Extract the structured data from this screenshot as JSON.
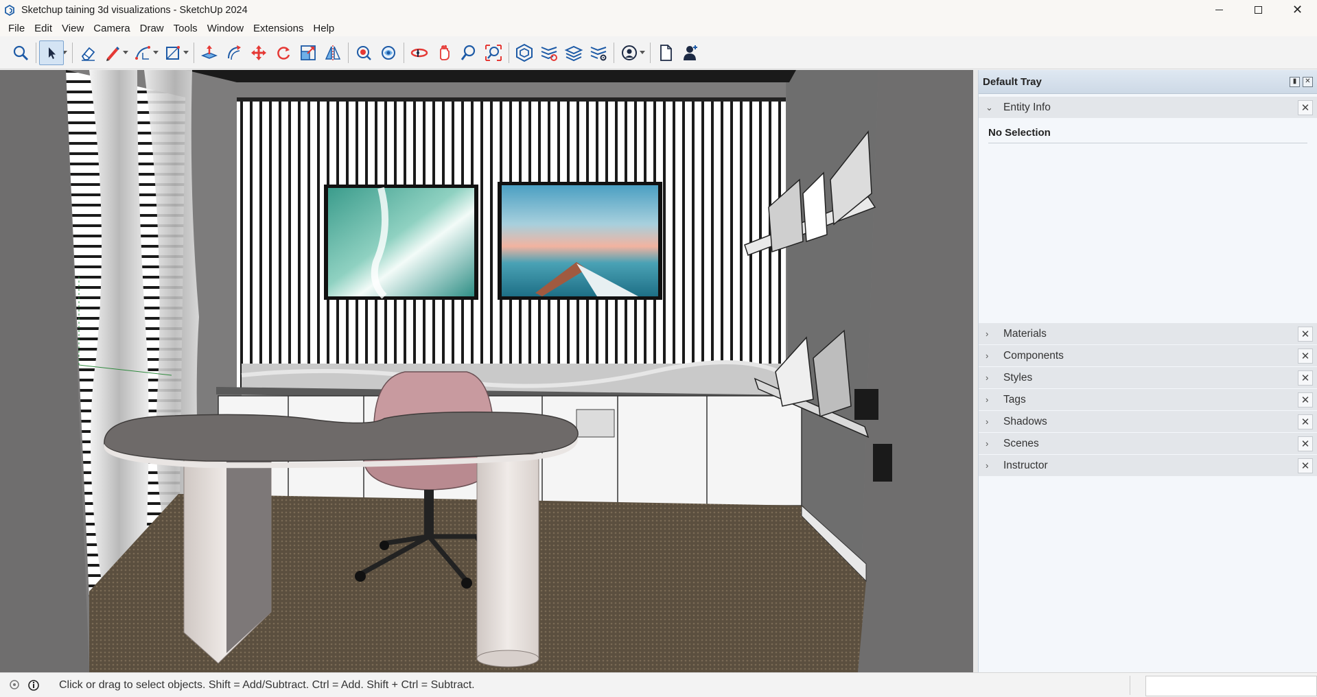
{
  "window": {
    "title": "Sketchup taining 3d visualizations - SketchUp 2024",
    "controls": [
      "minimize-icon",
      "restore-icon",
      "close-icon"
    ]
  },
  "menu": {
    "items": [
      "File",
      "Edit",
      "View",
      "Camera",
      "Draw",
      "Tools",
      "Window",
      "Extensions",
      "Help"
    ]
  },
  "toolbar": {
    "tools": [
      "search-icon",
      "select-icon",
      "eraser-icon",
      "pencil-icon",
      "arc-icon",
      "rectangle-icon",
      "push-pull-icon",
      "follow-me-icon",
      "move-icon",
      "rotate-icon",
      "scale-icon",
      "flip-icon",
      "paint-bucket-icon",
      "tape-measure-icon",
      "orbit-icon",
      "pan-icon",
      "zoom-icon",
      "zoom-extents-icon",
      "warehouse-icon",
      "extension-warehouse-icon",
      "layout-icon",
      "extension-manager-icon",
      "account-icon",
      "new-file-icon",
      "user-icon"
    ]
  },
  "tray": {
    "title": "Default Tray",
    "entity_info": {
      "label": "Entity Info",
      "status": "No Selection"
    },
    "panels": [
      "Materials",
      "Components",
      "Styles",
      "Tags",
      "Shadows",
      "Scenes",
      "Instructor"
    ]
  },
  "status": {
    "message": "Click or drag to select objects. Shift = Add/Subtract. Ctrl = Add. Shift + Ctrl = Subtract."
  },
  "colors": {
    "accent": "#7aa3cf",
    "tray_header": "#cdd9e6",
    "viewport_bg": "#6f6e6e"
  }
}
